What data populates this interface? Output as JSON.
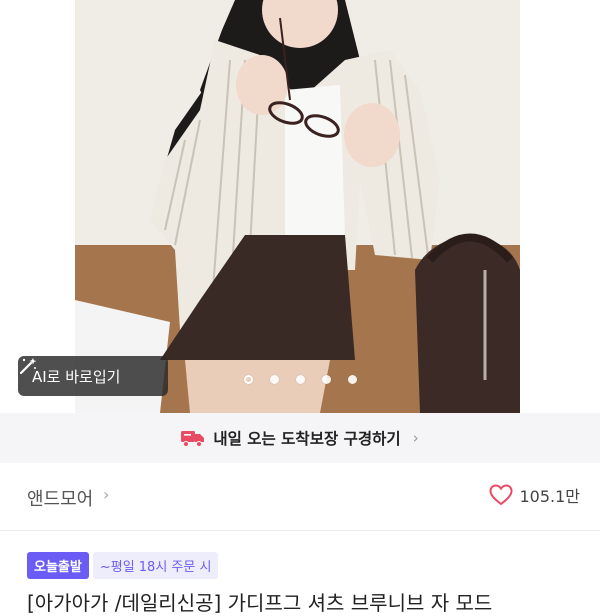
{
  "gallery": {
    "ai_button_label": "AI로 바로입기",
    "slide_count": 5,
    "active_slide": 1,
    "icons": {
      "ai": "magic-wand-icon",
      "expand": "expand-icon"
    }
  },
  "delivery_banner": {
    "text": "내일 오는 도착보장 구경하기",
    "chevron": "›",
    "icon": "delivery-truck-icon",
    "accent": "#e84b64"
  },
  "store": {
    "name": "앤드모어",
    "chevron": "›",
    "likes": "105.1만",
    "heart_color": "#e84b64"
  },
  "product": {
    "badge_primary": "오늘출발",
    "badge_secondary": "~평일 18시 주문 시",
    "title": "[아가아가 /데일리신공] 가디프그 셔츠 브루니브 자 모드",
    "accent": "#6a5cf5"
  }
}
